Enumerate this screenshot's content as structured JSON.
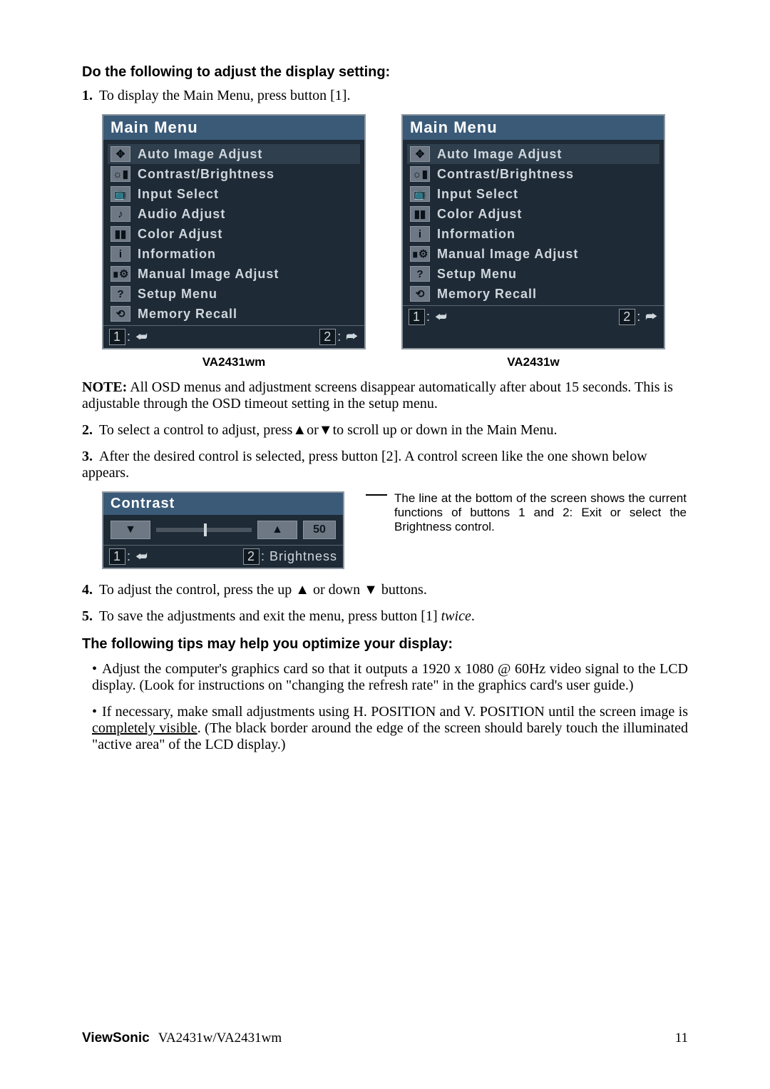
{
  "headings": {
    "adjust": "Do the following to adjust the display setting:",
    "tips": "The following tips may help you optimize your display:"
  },
  "steps": {
    "s1": "To display the Main Menu, press button [1].",
    "s2_a": "To select a control to adjust, press",
    "s2_b": "or",
    "s2_c": "to scroll up or down in the Main Menu.",
    "s3": "After the desired control is selected, press button [2]. A control screen like the one shown below appears.",
    "s4_a": "To adjust the control, press the up ",
    "s4_b": " or down ",
    "s4_c": " buttons.",
    "s5_a": "To save the adjustments and exit the menu, press button [1] ",
    "s5_b": "twice",
    "s5_c": "."
  },
  "menu": {
    "title": "Main Menu",
    "items_wm": [
      "Auto Image Adjust",
      "Contrast/Brightness",
      "Input Select",
      "Audio Adjust",
      "Color Adjust",
      "Information",
      "Manual Image Adjust",
      "Setup Menu",
      "Memory Recall"
    ],
    "items_w": [
      "Auto Image Adjust",
      "Contrast/Brightness",
      "Input Select",
      "Color Adjust",
      "Information",
      "Manual Image Adjust",
      "Setup Menu",
      "Memory Recall"
    ],
    "footer1": "1",
    "footer2": "2",
    "model_left": "VA2431wm",
    "model_right": "VA2431w"
  },
  "glyphs": {
    "g0": "✥",
    "g1": "☼▮",
    "g2": "📺",
    "g3": "♪",
    "g4": "▮▮",
    "g5": "i",
    "g6": "∎⚙",
    "g7": "?",
    "g8": "⟲"
  },
  "note": {
    "label": "NOTE:",
    "text": " All OSD menus and adjustment screens disappear automatically after about 15 seconds. This is adjustable through the OSD timeout setting in the setup menu."
  },
  "contrast": {
    "title": "Contrast",
    "value": "50",
    "footer_left": "1",
    "footer_right_key": "2",
    "footer_right_label": ": Brightness"
  },
  "callout": "The line at the bottom of the screen shows the current functions of buttons 1 and 2: Exit or select the Brightness control.",
  "bullets": {
    "b1": "Adjust the computer's graphics card so that it outputs a 1920 x 1080 @ 60Hz video signal to the LCD display. (Look for instructions on \"changing the refresh rate\" in the graphics card's user guide.)",
    "b2_a": "If necessary, make small adjustments using H. POSITION and V. POSITION until the screen image is ",
    "b2_u": "completely visible",
    "b2_b": ". (The black border around the edge of the screen should barely touch the illuminated \"active area\" of the LCD display.)"
  },
  "footer": {
    "brand": "ViewSonic",
    "models": "VA2431w/VA2431wm",
    "page": "11"
  },
  "arrows": {
    "up": "▲",
    "down": "▼",
    "enter": "⮫",
    "exit": "⮨"
  }
}
